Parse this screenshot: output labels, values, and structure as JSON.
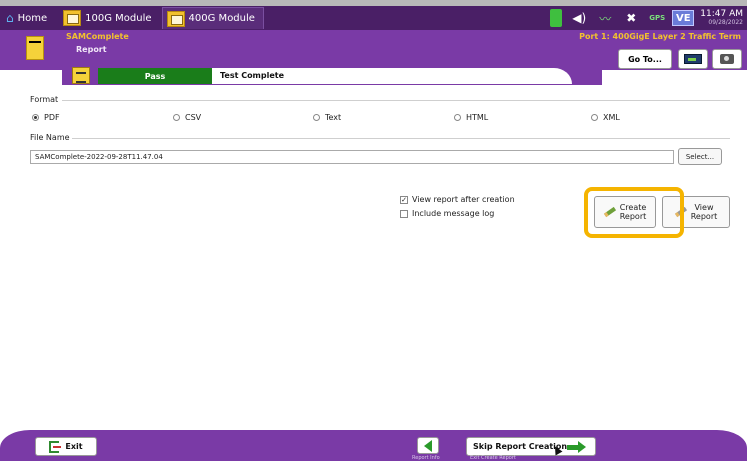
{
  "navbar": {
    "home_label": "Home",
    "tabs": [
      {
        "label": "100G Module",
        "active": false
      },
      {
        "label": "400G Module",
        "active": true
      }
    ],
    "status": {
      "time": "11:47 AM",
      "date": "09/28/2022",
      "gps_label": "GPS",
      "ve_label": "VE"
    }
  },
  "header": {
    "app": "SAMComplete",
    "page": "Report",
    "port": "Port 1: 400GigE Layer 2 Traffic Term",
    "goto_label": "Go To..."
  },
  "status_bar": {
    "result": "Pass",
    "message": "Test Complete"
  },
  "format": {
    "label": "Format",
    "options": [
      {
        "label": "PDF",
        "selected": true
      },
      {
        "label": "CSV",
        "selected": false
      },
      {
        "label": "Text",
        "selected": false
      },
      {
        "label": "HTML",
        "selected": false
      },
      {
        "label": "XML",
        "selected": false
      }
    ]
  },
  "file_name": {
    "label": "File Name",
    "value": "SAMComplete-2022-09-28T11.47.04",
    "select_label": "Select..."
  },
  "options": {
    "view_after": {
      "label": "View report after creation",
      "checked": true
    },
    "include_log": {
      "label": "Include message log",
      "checked": false
    }
  },
  "actions": {
    "create_line1": "Create",
    "create_line2": "Report",
    "view_line1": "View",
    "view_line2": "Report"
  },
  "bottom": {
    "exit_label": "Exit",
    "skip_label": "Skip Report Creation",
    "back_sub": "Report Info",
    "skip_sub": "Exit Create Report"
  },
  "colors": {
    "nav": "#4a1f66",
    "header": "#7a3aa6",
    "pass": "#1a7d1a",
    "accent": "#f2c12e",
    "highlight": "#f5b400"
  }
}
